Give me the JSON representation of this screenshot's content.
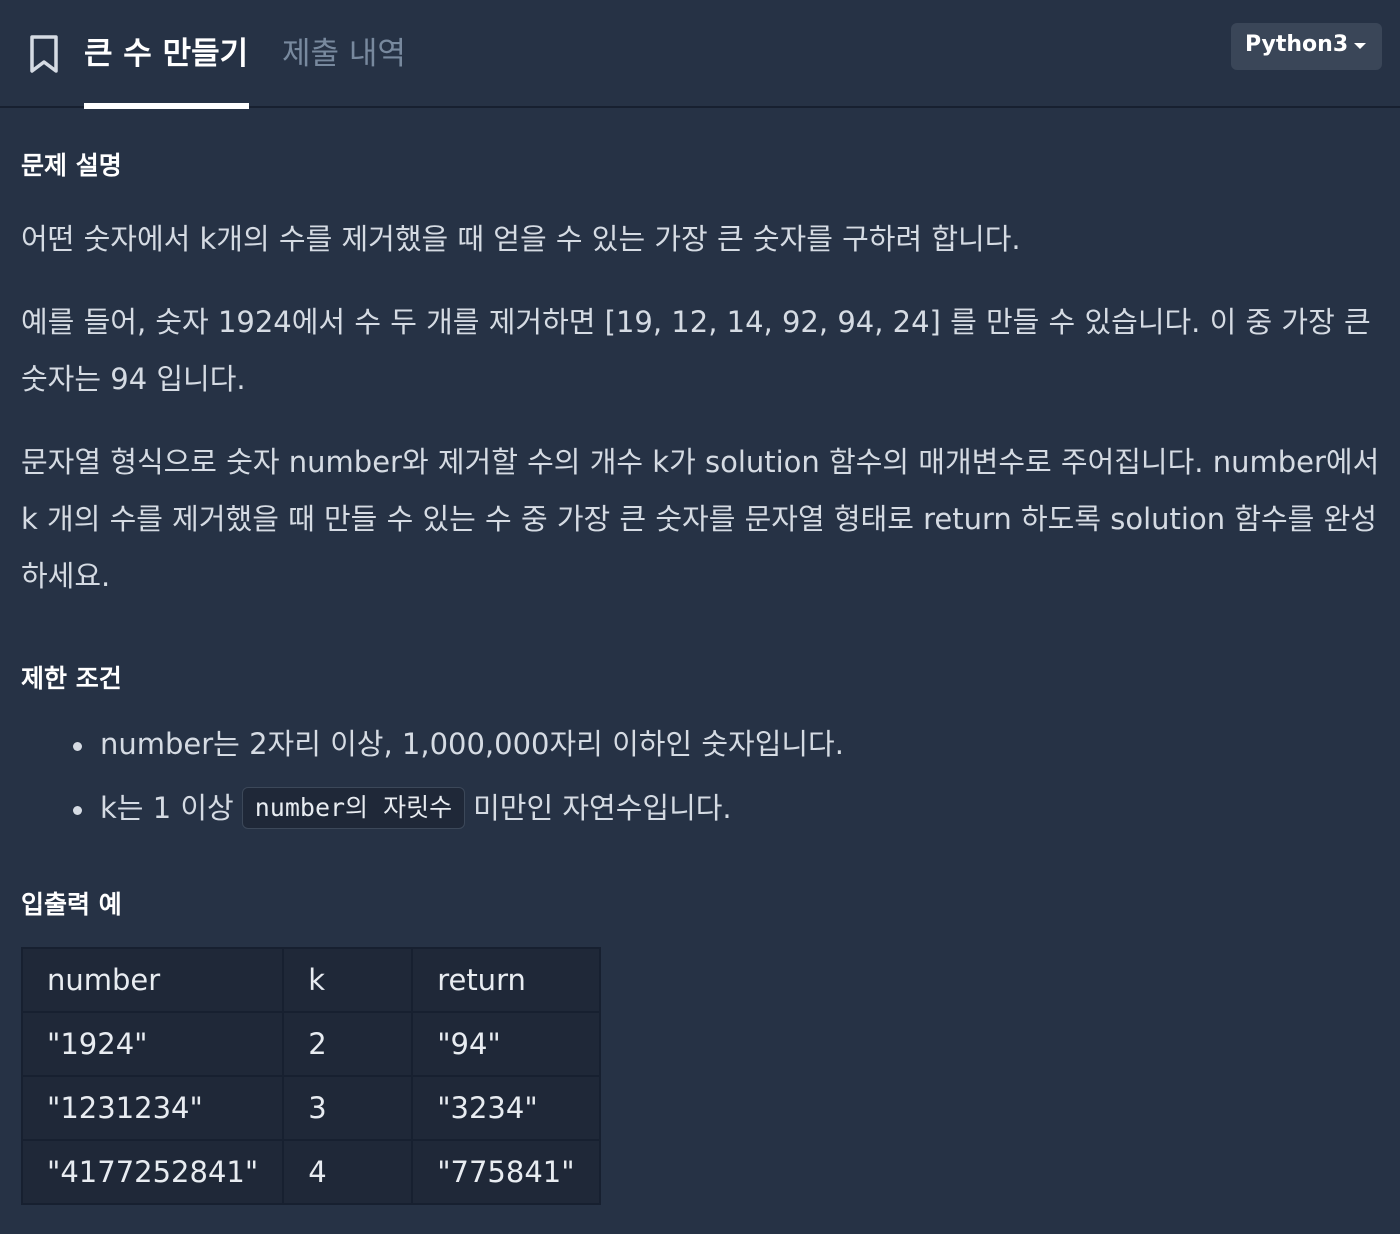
{
  "header": {
    "tabs": [
      {
        "label": "큰 수 만들기",
        "active": true
      },
      {
        "label": "제출 내역",
        "active": false
      }
    ],
    "language": "Python3"
  },
  "problem": {
    "section_title": "문제 설명",
    "paragraphs": [
      "어떤 숫자에서 k개의 수를 제거했을 때 얻을 수 있는 가장 큰 숫자를 구하려 합니다.",
      "예를 들어, 숫자 1924에서 수 두 개를 제거하면 [19, 12, 14, 92, 94, 24] 를 만들 수 있습니다. 이 중 가장 큰 숫자는 94 입니다.",
      "문자열 형식으로 숫자 number와 제거할 수의 개수 k가 solution 함수의 매개변수로 주어집니다. number에서 k 개의 수를 제거했을 때 만들 수 있는 수 중 가장 큰 숫자를 문자열 형태로 return 하도록 solution 함수를 완성하세요."
    ]
  },
  "constraints": {
    "title": "제한 조건",
    "item1": "number는 2자리 이상, 1,000,000자리 이하인 숫자입니다.",
    "item2_prefix": "k는 1 이상",
    "item2_code": "number의 자릿수",
    "item2_suffix": "미만인 자연수입니다."
  },
  "examples": {
    "title": "입출력 예",
    "headers": [
      "number",
      "k",
      "return"
    ],
    "rows": [
      [
        "\"1924\"",
        "2",
        "\"94\""
      ],
      [
        "\"1231234\"",
        "3",
        "\"3234\""
      ],
      [
        "\"4177252841\"",
        "4",
        "\"775841\""
      ]
    ]
  }
}
